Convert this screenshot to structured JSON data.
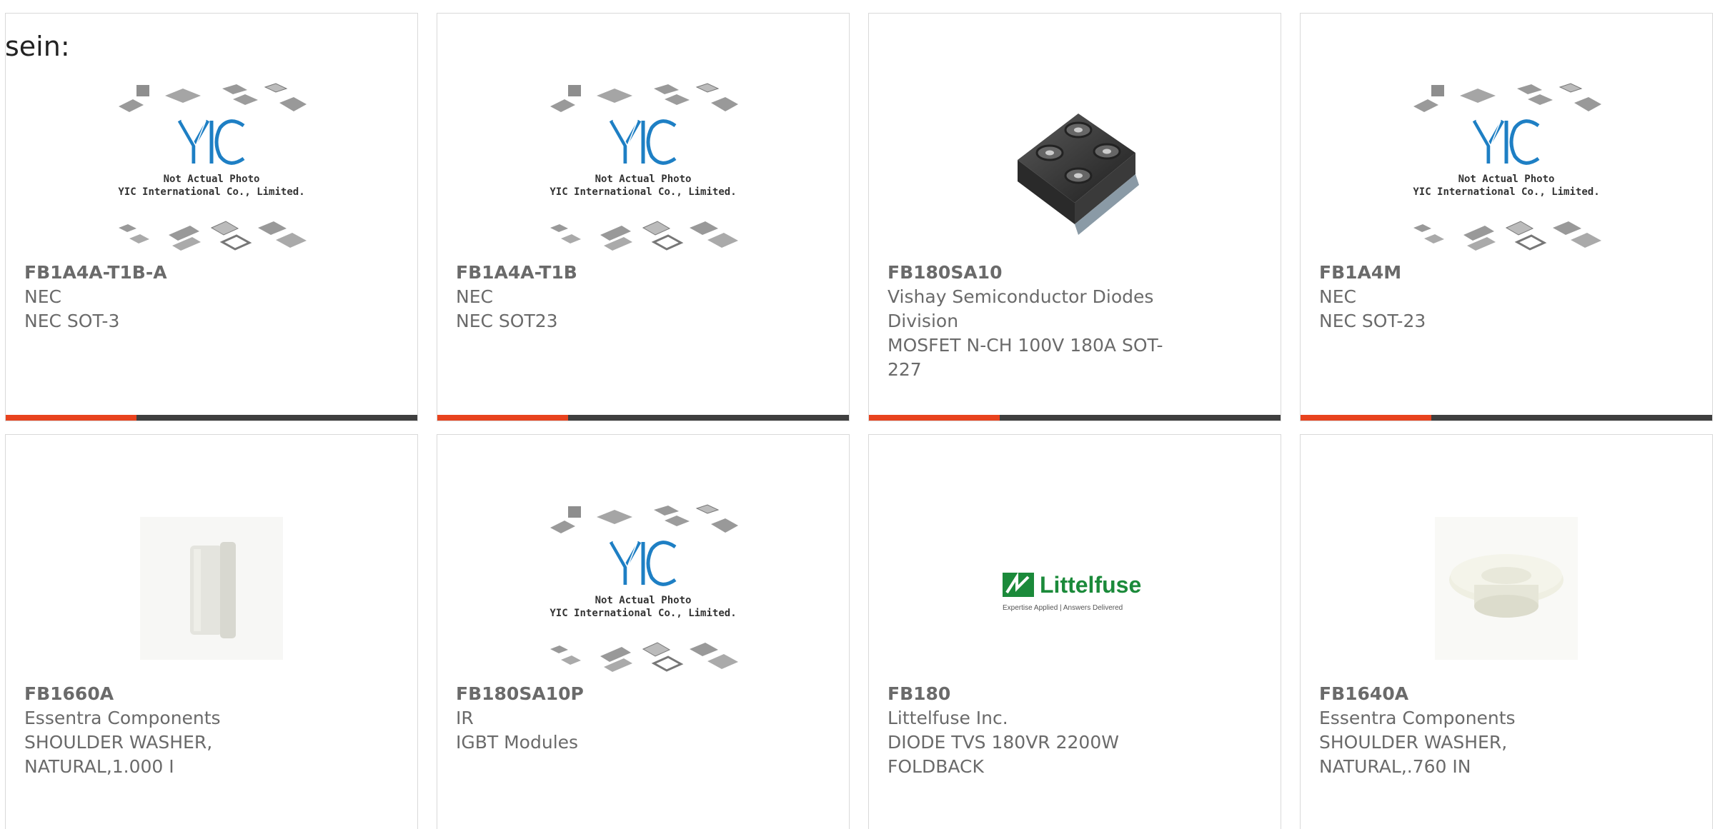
{
  "lead_text": "sein:",
  "placeholder": {
    "line1": "Not Actual Photo",
    "line2": "YIC International Co., Limited.",
    "logo_text": "YIC"
  },
  "littelfuse": {
    "brand": "Littelfuse",
    "tagline": "Expertise Applied | Answers Delivered"
  },
  "colors": {
    "accent_red": "#e8431e",
    "accent_dark": "#3f3f3f",
    "text_gray": "#6a6a6a",
    "logo_blue": "#1e7fc4",
    "littelfuse_green": "#1b8a3a"
  },
  "products": [
    {
      "pn": "FB1A4A-T1B-A",
      "mfr": "NEC",
      "desc": "NEC SOT-3",
      "image": "yic-placeholder"
    },
    {
      "pn": "FB1A4A-T1B",
      "mfr": "NEC",
      "desc": "NEC SOT23",
      "image": "yic-placeholder"
    },
    {
      "pn": "FB180SA10",
      "mfr": "Vishay Semiconductor Diodes Division",
      "desc": "MOSFET N-CH 100V 180A SOT-227",
      "image": "sot227-module"
    },
    {
      "pn": "FB1A4M",
      "mfr": "NEC",
      "desc": "NEC SOT-23",
      "image": "yic-placeholder"
    },
    {
      "pn": "FB1660A",
      "mfr": "Essentra Components",
      "desc": "SHOULDER WASHER, NATURAL,1.000 I",
      "image": "shoulder-washer-side"
    },
    {
      "pn": "FB180SA10P",
      "mfr": "IR",
      "desc": "IGBT Modules",
      "image": "yic-placeholder"
    },
    {
      "pn": "FB180",
      "mfr": "Littelfuse Inc.",
      "desc": "DIODE TVS 180VR 2200W FOLDBACK",
      "image": "littelfuse-logo"
    },
    {
      "pn": "FB1640A",
      "mfr": "Essentra Components",
      "desc": "SHOULDER WASHER, NATURAL,.760 IN",
      "image": "shoulder-washer-top"
    }
  ]
}
